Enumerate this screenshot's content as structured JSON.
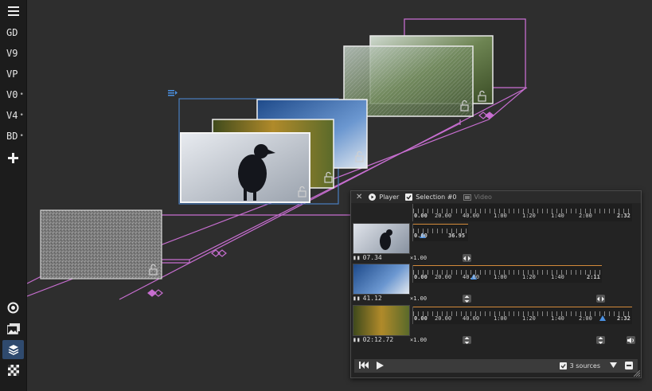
{
  "sidebar": {
    "items": [
      {
        "label": "GD",
        "dot": ""
      },
      {
        "label": "V9",
        "dot": ""
      },
      {
        "label": "VP",
        "dot": ""
      },
      {
        "label": "V0",
        "dot": "•"
      },
      {
        "label": "V4",
        "dot": "•"
      },
      {
        "label": "BD",
        "dot": "•"
      }
    ],
    "icons": [
      "menu-icon",
      "add-icon",
      "target-icon",
      "images-icon",
      "layers-icon",
      "checker-icon"
    ]
  },
  "player": {
    "tab_player": "Player",
    "tab_selection": "Selection #0",
    "tab_video": "Video",
    "ruler": {
      "start": "0.00",
      "marks": [
        "20.00",
        "40.00",
        "1:00",
        "1:20",
        "1:40",
        "2:00"
      ],
      "end": "2:32"
    },
    "tracks": [
      {
        "time": "07.34",
        "speed": "×1.00",
        "start": "0.00",
        "end": "36.95",
        "marks": [],
        "marker": 0.15
      },
      {
        "time": "41.12",
        "speed": "×1.00",
        "start": "0.00",
        "end": "2:11",
        "marks": [
          "20.00",
          "40.00",
          "1:00",
          "1:20",
          "1:40"
        ],
        "marker": 0.31
      },
      {
        "time": "02:12.72",
        "speed": "×1.00",
        "start": "0.00",
        "end": "2:32",
        "marks": [
          "20.00",
          "40.00",
          "1:00",
          "1:20",
          "1:40",
          "2:00"
        ],
        "marker": 0.86
      }
    ],
    "footer": {
      "sources_label": "3 sources"
    }
  },
  "colors": {
    "accent_pink": "#c76ed0",
    "accent_blue": "#4a7fc0",
    "marker_blue": "#4a90e2",
    "trim_orange": "#d38a3a"
  }
}
